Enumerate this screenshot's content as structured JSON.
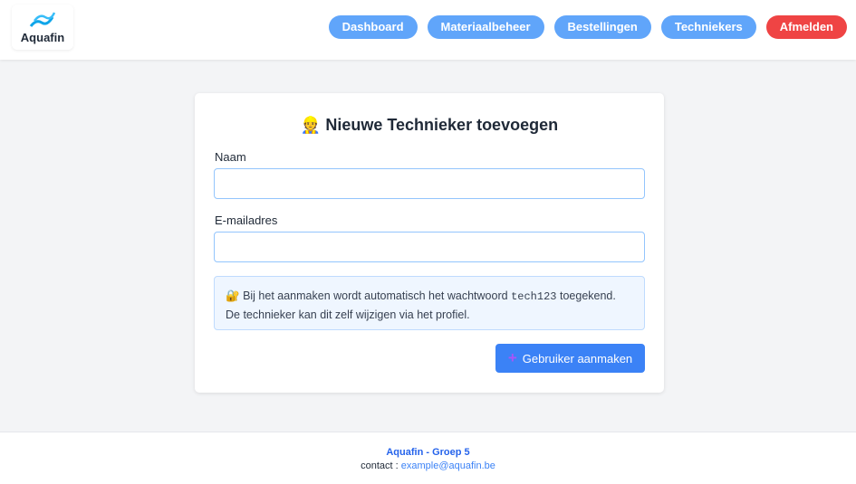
{
  "header": {
    "logo_text": "Aquafin",
    "nav": [
      "Dashboard",
      "Materiaalbeheer",
      "Bestellingen",
      "Techniekers"
    ],
    "logout": "Afmelden"
  },
  "form": {
    "icon": "👷",
    "title": "Nieuwe Technieker toevoegen",
    "name_label": "Naam",
    "name_value": "",
    "email_label": "E-mailadres",
    "email_value": "",
    "info_icon": "🔐",
    "info_pre": "Bij het aanmaken wordt automatisch het wachtwoord",
    "info_code": "tech123",
    "info_post": "toegekend.",
    "info_line2": "De technieker kan dit zelf wijzigen via het profiel.",
    "submit_icon": "+",
    "submit_label": "Gebruiker aanmaken"
  },
  "footer": {
    "title": "Aquafin - Groep 5",
    "contact_label": "contact :",
    "email": "example@aquafin.be"
  }
}
